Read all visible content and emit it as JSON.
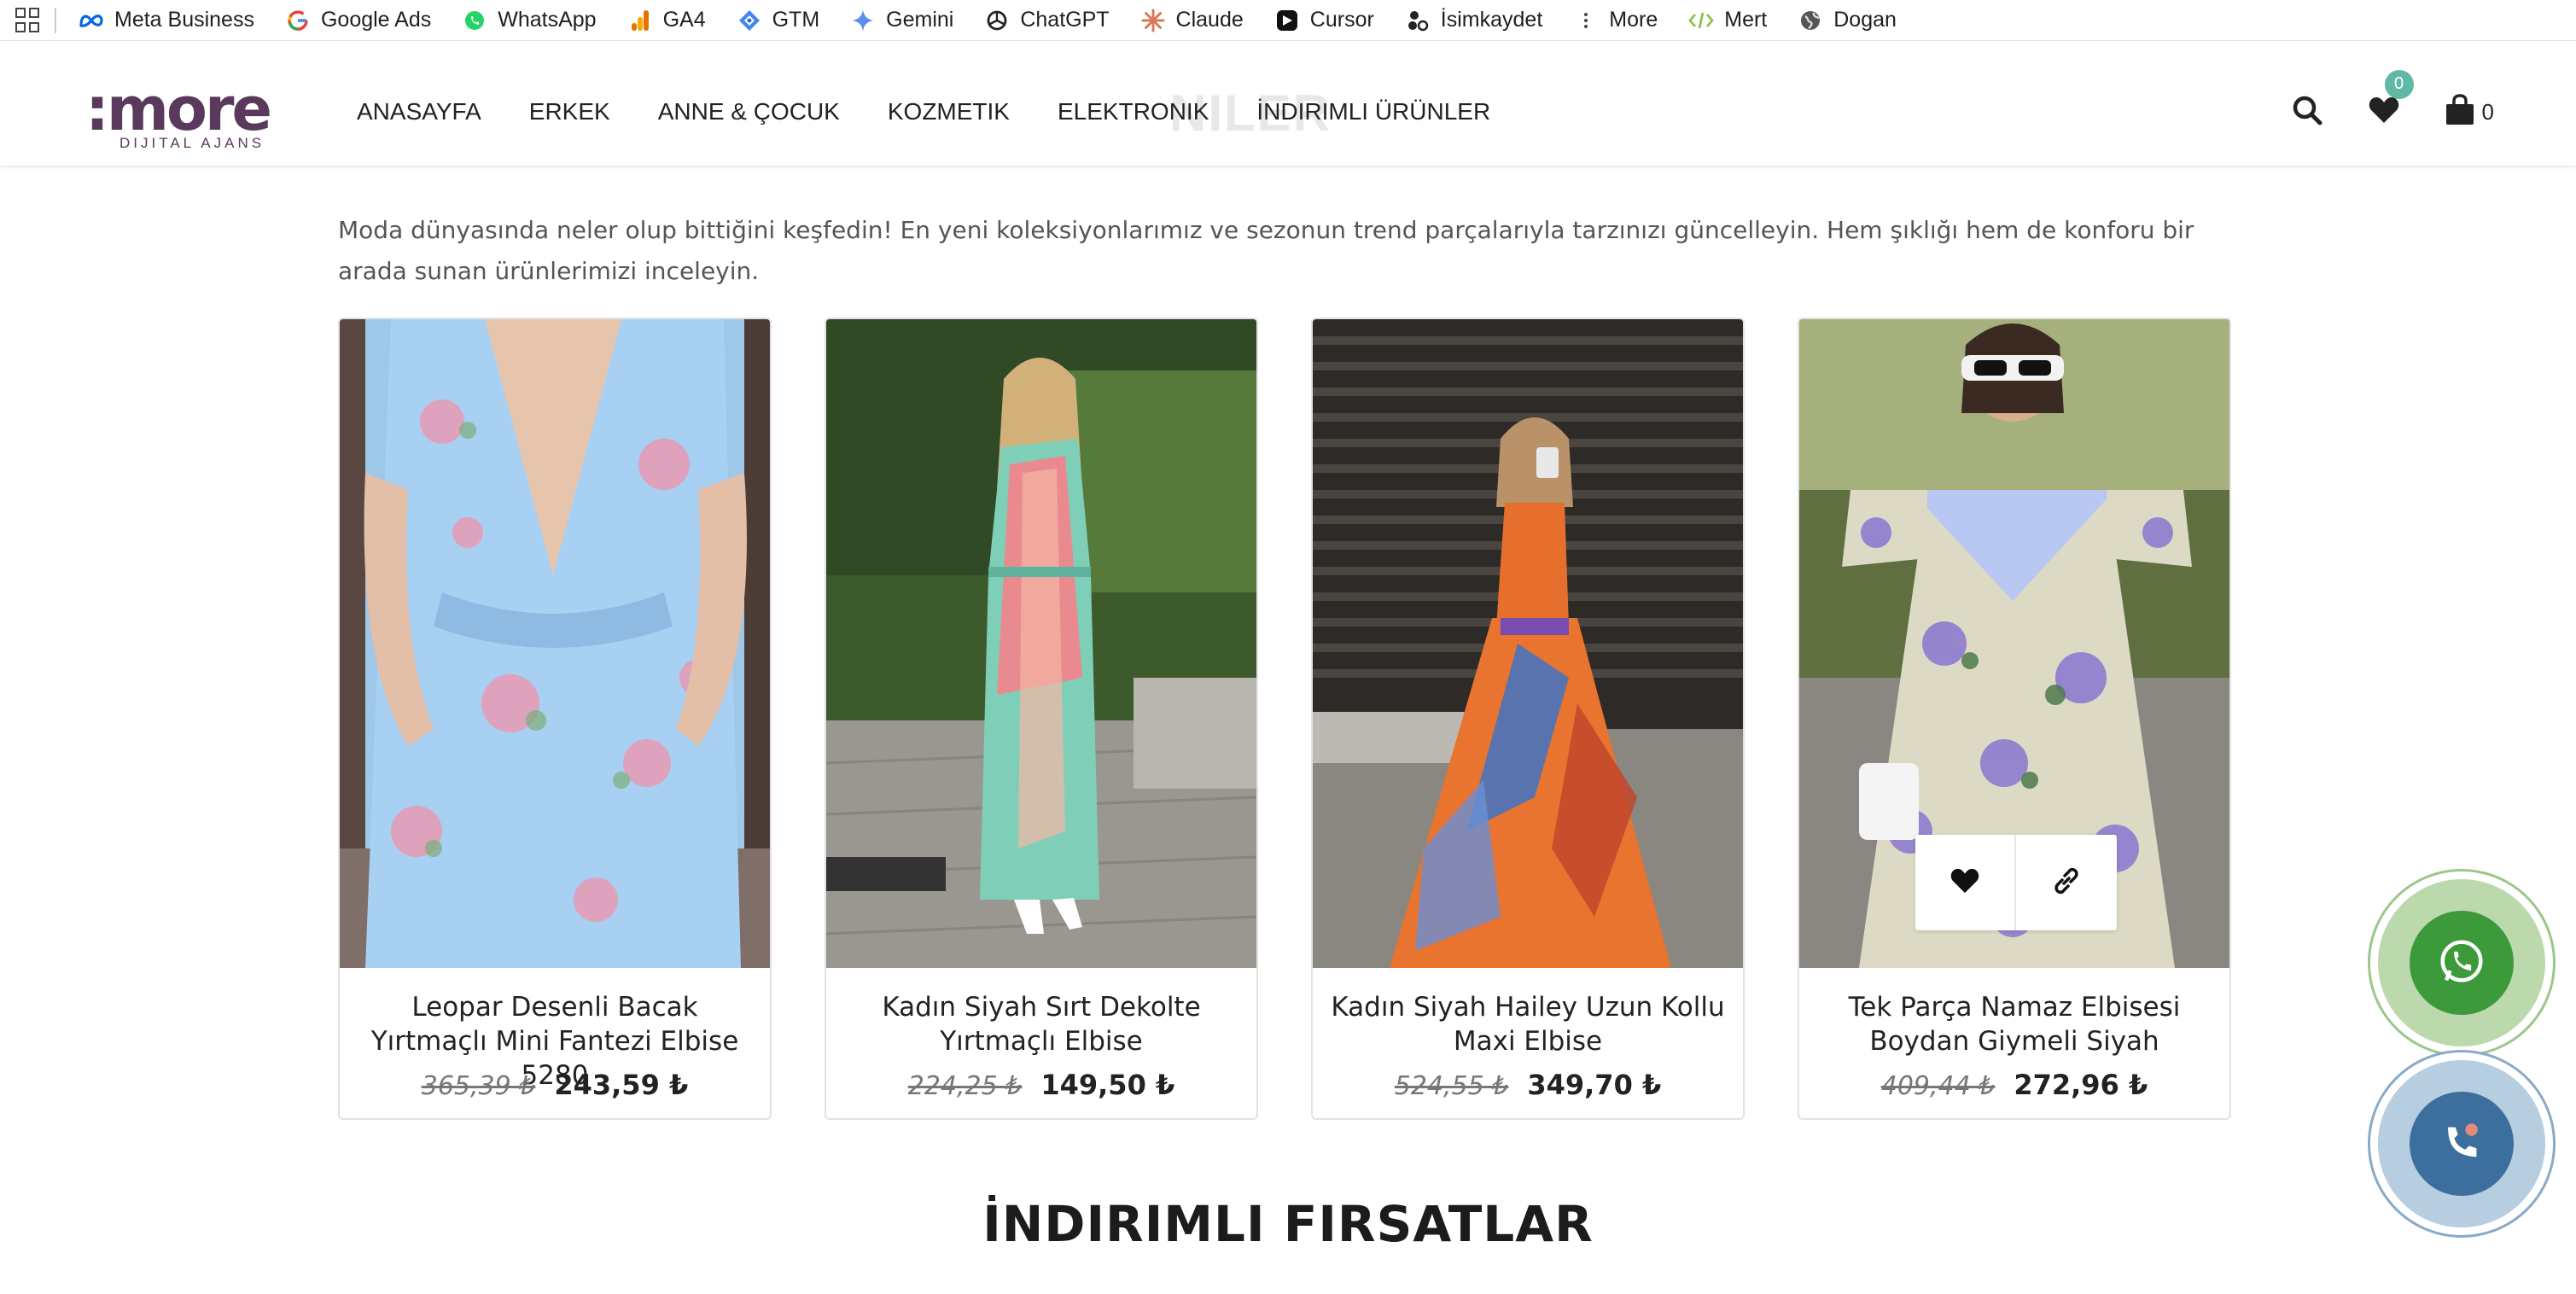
{
  "bookmarks": {
    "items": [
      {
        "label": "Meta Business",
        "icon": "meta-icon"
      },
      {
        "label": "Google Ads",
        "icon": "google-icon"
      },
      {
        "label": "WhatsApp",
        "icon": "whatsapp-icon"
      },
      {
        "label": "GA4",
        "icon": "analytics-icon"
      },
      {
        "label": "GTM",
        "icon": "gtm-icon"
      },
      {
        "label": "Gemini",
        "icon": "gemini-icon"
      },
      {
        "label": "ChatGPT",
        "icon": "chatgpt-icon"
      },
      {
        "label": "Claude",
        "icon": "claude-icon"
      },
      {
        "label": "Cursor",
        "icon": "cursor-icon"
      },
      {
        "label": "İsimkaydet",
        "icon": "isimkaydet-icon"
      },
      {
        "label": "More",
        "icon": "more-icon"
      },
      {
        "label": "Mert",
        "icon": "code-icon"
      },
      {
        "label": "Dogan",
        "icon": "globe-icon"
      }
    ]
  },
  "header": {
    "logo_text": ":more",
    "logo_sub": "DIJITAL AJANS",
    "nav": [
      "ANASAYFA",
      "ERKEK",
      "ANNE & ÇOCUK",
      "KOZMETIK",
      "ELEKTRONIK",
      "İNDIRIMLI ÜRÜNLER"
    ],
    "ghost_title": "NILER",
    "wishlist_count": "0",
    "cart_count": "0"
  },
  "intro": {
    "text": "Moda dünyasında neler olup bittiğini keşfedin! En yeni koleksiyonlarımız ve sezonun trend parçalarıyla tarzınızı güncelleyin. Hem şıklığı hem de konforu bir arada sunan ürünlerimizi inceleyin."
  },
  "products": [
    {
      "title": "Leopar Desenli Bacak Yırtmaçlı Mini Fantezi Elbise 5280",
      "old_price": "365,39 ₺",
      "new_price": "243,59 ₺"
    },
    {
      "title": "Kadın Siyah Sırt Dekolte Yırtmaçlı Elbise",
      "old_price": "224,25 ₺",
      "new_price": "149,50 ₺"
    },
    {
      "title": "Kadın Siyah Hailey Uzun Kollu Maxi Elbise",
      "old_price": "524,55 ₺",
      "new_price": "349,70 ₺"
    },
    {
      "title": "Tek Parça Namaz Elbisesi Boydan Giymeli Siyah",
      "old_price": "409,44 ₺",
      "new_price": "272,96 ₺"
    }
  ],
  "section": {
    "title": "İNDIRIMLI FIRSATLAR"
  },
  "colors": {
    "brand": "#5a3a5c",
    "badge": "#5fb9a6",
    "whatsapp": "#3d9a3b",
    "phone": "#3c6e9e"
  }
}
